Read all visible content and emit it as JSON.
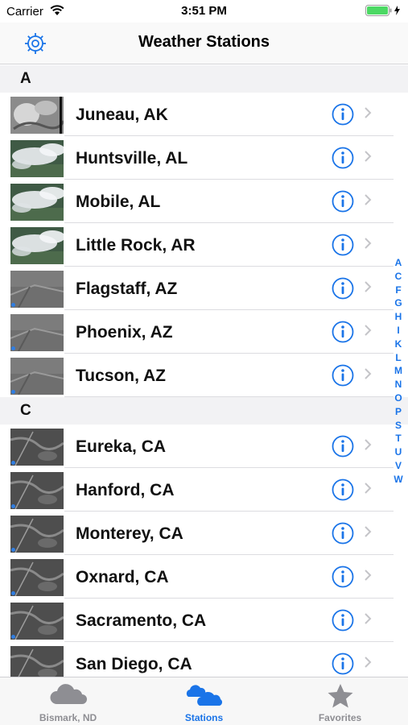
{
  "status_bar": {
    "carrier": "Carrier",
    "time": "3:51 PM"
  },
  "nav": {
    "title": "Weather Stations",
    "settings_icon": "gear-icon"
  },
  "sections": [
    {
      "letter": "A",
      "rows": [
        {
          "name": "Juneau, AK",
          "thumb": "bw"
        },
        {
          "name": "Huntsville, AL",
          "thumb": "cloud"
        },
        {
          "name": "Mobile, AL",
          "thumb": "cloud"
        },
        {
          "name": "Little Rock, AR",
          "thumb": "cloud"
        },
        {
          "name": "Flagstaff, AZ",
          "thumb": "gray"
        },
        {
          "name": "Phoenix, AZ",
          "thumb": "gray"
        },
        {
          "name": "Tucson, AZ",
          "thumb": "gray"
        }
      ]
    },
    {
      "letter": "C",
      "rows": [
        {
          "name": "Eureka, CA",
          "thumb": "dark"
        },
        {
          "name": "Hanford, CA",
          "thumb": "dark"
        },
        {
          "name": "Monterey, CA",
          "thumb": "dark"
        },
        {
          "name": "Oxnard, CA",
          "thumb": "dark"
        },
        {
          "name": "Sacramento, CA",
          "thumb": "dark"
        },
        {
          "name": "San Diego, CA",
          "thumb": "dark"
        }
      ]
    }
  ],
  "index_letters": [
    "A",
    "C",
    "F",
    "G",
    "H",
    "I",
    "K",
    "L",
    "M",
    "N",
    "O",
    "P",
    "S",
    "T",
    "U",
    "V",
    "W"
  ],
  "tabs": [
    {
      "label": "Bismark, ND",
      "icon": "cloud-icon",
      "active": false
    },
    {
      "label": "Stations",
      "icon": "clouds-icon",
      "active": true
    },
    {
      "label": "Favorites",
      "icon": "star-icon",
      "active": false
    }
  ],
  "colors": {
    "accent": "#1a74e8",
    "inactive": "#8e8e93",
    "battery": "#4cd964"
  }
}
